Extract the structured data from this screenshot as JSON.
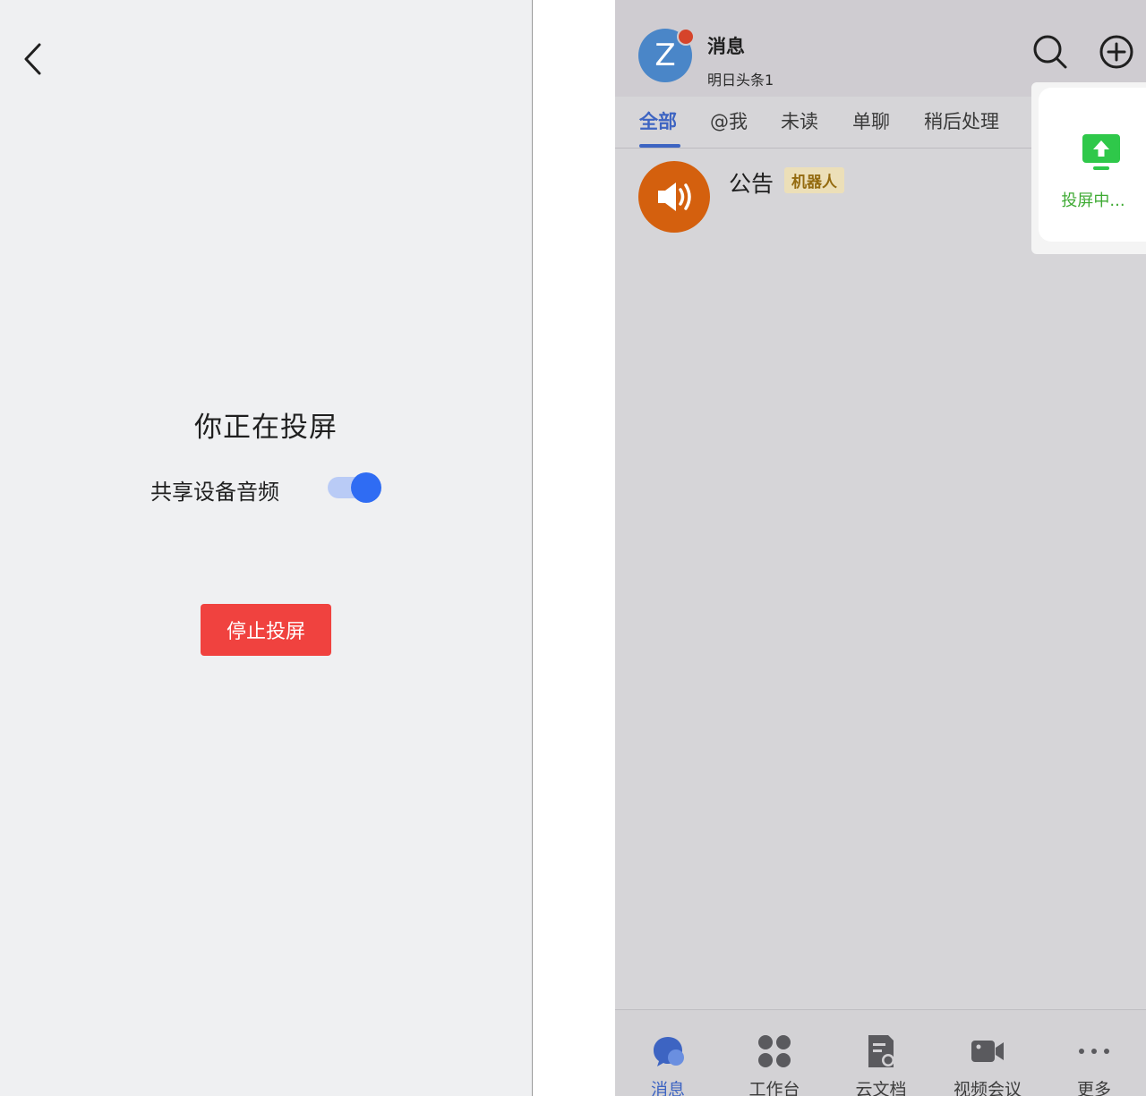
{
  "left": {
    "title": "你正在投屏",
    "audio_label": "共享设备音频",
    "audio_enabled": true,
    "stop_label": "停止投屏"
  },
  "right": {
    "header": {
      "avatar_letter": "Z",
      "title": "消息",
      "subtitle": "明日头条1"
    },
    "tabs": [
      {
        "label": "全部",
        "active": true
      },
      {
        "label": "@我",
        "active": false
      },
      {
        "label": "未读",
        "active": false
      },
      {
        "label": "单聊",
        "active": false
      },
      {
        "label": "稍后处理",
        "active": false
      }
    ],
    "list": [
      {
        "title": "公告",
        "badge": "机器人"
      }
    ],
    "casting": {
      "label": "投屏中..."
    },
    "nav": [
      {
        "label": "消息",
        "icon": "chat-bubble-icon",
        "active": true
      },
      {
        "label": "工作台",
        "icon": "grid-icon",
        "active": false
      },
      {
        "label": "云文档",
        "icon": "doc-icon",
        "active": false
      },
      {
        "label": "视频会议",
        "icon": "video-camera-icon",
        "active": false
      },
      {
        "label": "更多",
        "icon": "more-dots-icon",
        "active": false
      }
    ]
  },
  "colors": {
    "accent_blue": "#2f6cf3",
    "stop_red": "#f0423f",
    "tab_active": "#3d64c2",
    "cast_green": "#3eaa33",
    "notice_orange": "#d4600e"
  }
}
